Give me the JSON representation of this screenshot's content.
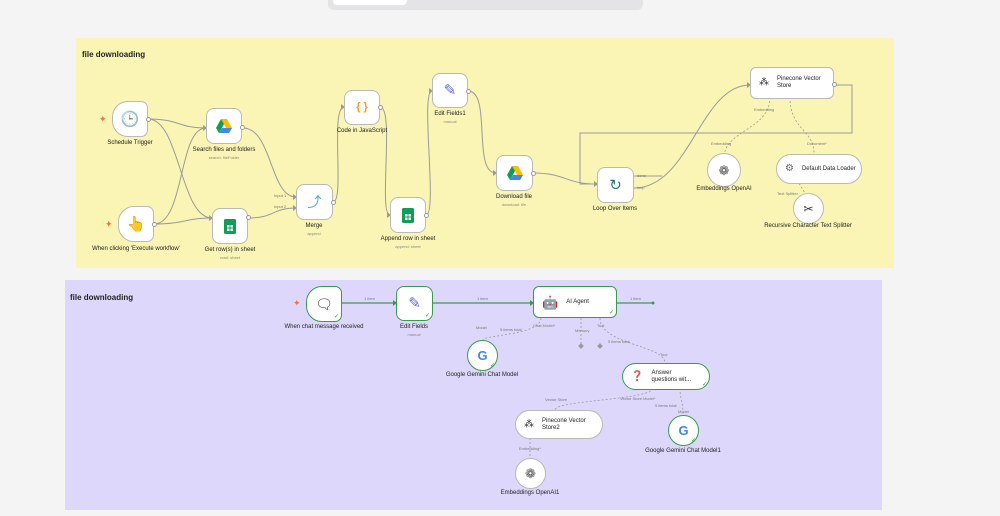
{
  "workflows": [
    {
      "title": "file downloading",
      "nodes": {
        "schedule": {
          "label": "Schedule Trigger",
          "icon": "clock-icon"
        },
        "manual": {
          "label": "When clicking 'Execute workflow'",
          "icon": "cursor-click-icon"
        },
        "search": {
          "label": "Search files and folders",
          "sub": "search: fileFolder",
          "icon": "google-drive-icon"
        },
        "getrows": {
          "label": "Get row(s) in sheet",
          "sub": "read: sheet",
          "icon": "google-sheets-icon"
        },
        "merge": {
          "label": "Merge",
          "sub": "append",
          "icon": "merge-icon",
          "input1": "Input 1",
          "input2": "Input 2"
        },
        "code": {
          "label": "Code in JavaScript",
          "glyph": "{ }",
          "icon": "code-icon"
        },
        "append": {
          "label": "Append row in sheet",
          "sub": "append: sheet",
          "icon": "google-sheets-icon"
        },
        "editfields1": {
          "label": "Edit Fields1",
          "sub": "manual",
          "icon": "pencil-icon"
        },
        "download": {
          "label": "Download file",
          "sub": "download: file",
          "icon": "google-drive-icon"
        },
        "loop": {
          "label": "Loop Over Items",
          "done": "done",
          "loop": "loop",
          "icon": "loop-icon"
        },
        "pinecone": {
          "label": "Pinecone Vector Store",
          "embedding": "Embedding",
          "document": "Document*",
          "icon": "pinecone-icon"
        },
        "embeddings": {
          "label": "Embeddings OpenAI",
          "icon": "openai-icon"
        },
        "loader": {
          "label": "Default Data Loader",
          "text_splitter": "Text Splitter",
          "icon": "data-loader-icon"
        },
        "splitter": {
          "label": "Recursive Character Text Splitter",
          "icon": "scissors-icon"
        }
      }
    },
    {
      "title": "file downloading",
      "nodes": {
        "chat": {
          "label": "When chat message received",
          "icon": "chat-bubble-icon"
        },
        "editfields": {
          "label": "Edit Fields",
          "sub": "manual",
          "icon": "pencil-icon"
        },
        "agent": {
          "label": "AI Agent",
          "chat_model": "Chat Model*",
          "memory": "Memory",
          "tool": "Tool",
          "icon": "robot-icon"
        },
        "gemini": {
          "label": "Google Gemini Chat Model",
          "model": "Model",
          "items": "5 items total",
          "icon": "google-g-icon"
        },
        "answer": {
          "label": "Answer questions wit...",
          "tool": "Tool",
          "vector_store": "Vector Store",
          "model": "Model",
          "icon": "question-icon"
        },
        "pinecone2": {
          "label": "Pinecone Vector Store2",
          "embedding": "Embedding*",
          "icon": "pinecone-icon"
        },
        "gemini1": {
          "label": "Google Gemini Chat Model1",
          "items": "5 items total",
          "icon": "google-g-icon"
        },
        "embeddings1": {
          "label": "Embeddings OpenAI1",
          "icon": "openai-icon"
        }
      },
      "edge_labels": {
        "chat_to_edit": "1 item",
        "edit_to_agent": "1 item",
        "agent_out": "1 item",
        "agent_tool_items": "5 items total",
        "answer_vs_model": "Vector Store Model*"
      }
    }
  ],
  "colors": {
    "yellow_sticky": "#faf5b4",
    "purple_sticky": "#ddd8fb",
    "success_green": "#3a9a4c",
    "trigger_orange": "#ff6d3b"
  }
}
